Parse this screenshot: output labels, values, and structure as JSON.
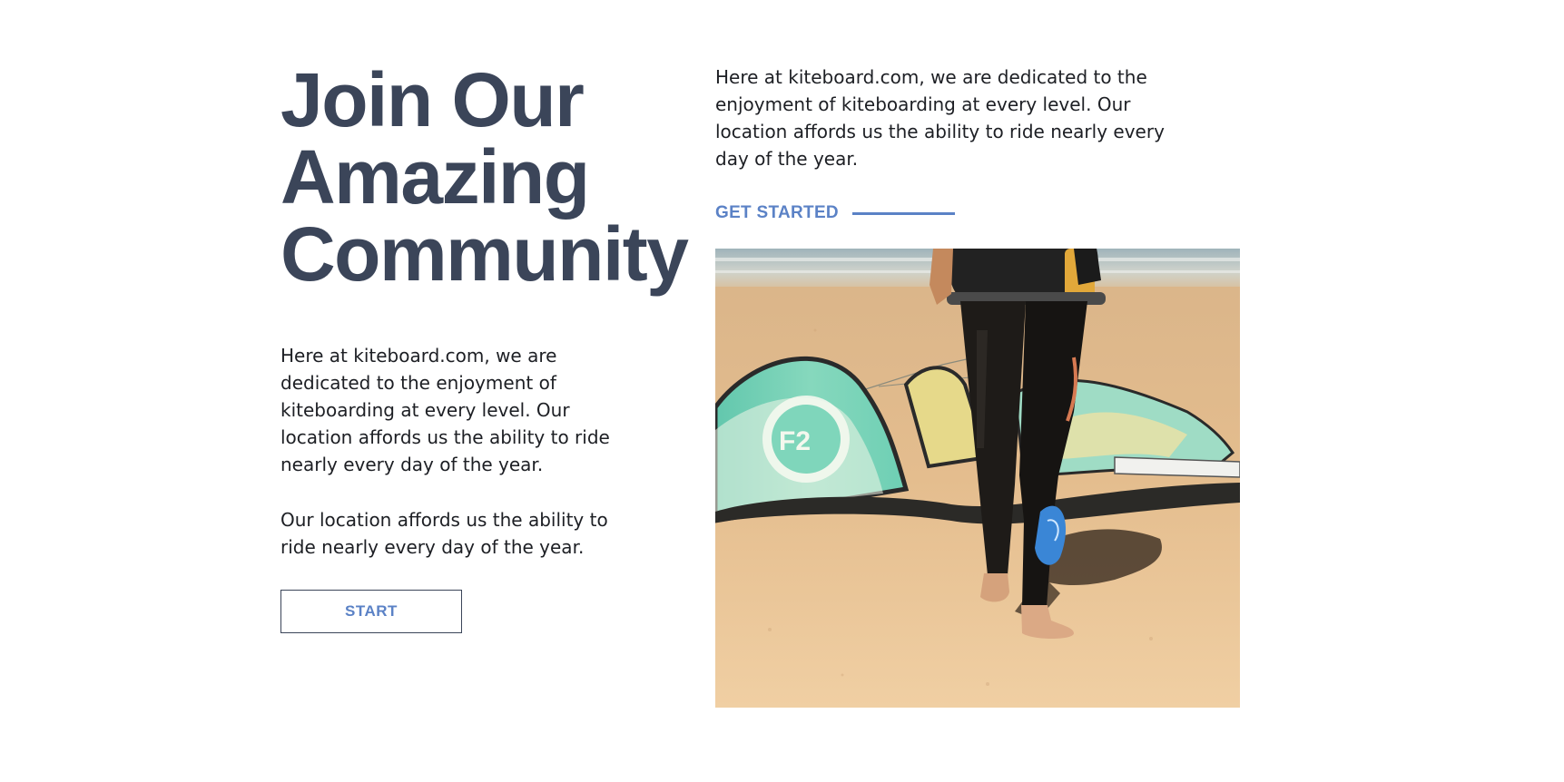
{
  "hero": {
    "headline_line1": "Join Our",
    "headline_line2": "Amazing",
    "headline_line3": "Community"
  },
  "left": {
    "paragraph1": "Here at kiteboard.com, we are dedicated to the enjoyment of kiteboarding at every level. Our location affords us the ability to ride nearly every day of the year.",
    "paragraph2": "Our location affords us the ability to ride nearly every day of the year.",
    "start_button_label": "START"
  },
  "right": {
    "paragraph": "Here at kiteboard.com, we are dedicated to the enjoyment of kiteboarding at every level. Our location affords us the ability to ride nearly every day of the year.",
    "cta_label": "GET STARTED",
    "photo_icon": "kiteboarder-on-beach-photo"
  },
  "colors": {
    "heading": "#3b4559",
    "accent": "#5b82c6",
    "body_text": "#1d1f24",
    "background": "#ffffff"
  }
}
